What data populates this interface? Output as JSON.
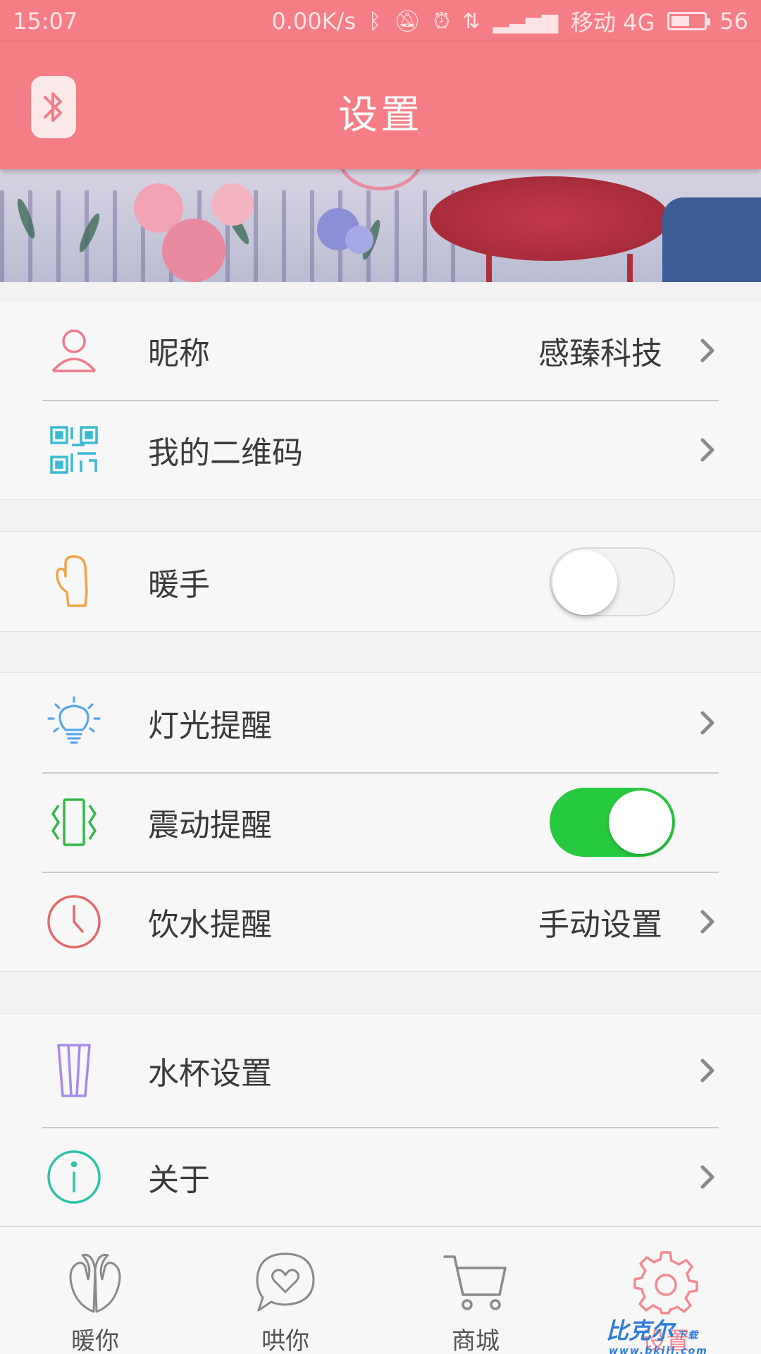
{
  "status_bar": {
    "time": "15:07",
    "net_speed": "0.00K/s",
    "carrier": "移动 4G",
    "battery": "56",
    "battery_level": 0.56
  },
  "header": {
    "title": "设置",
    "bluetooth_icon": "bluetooth-icon",
    "color": "#f57d86"
  },
  "groups": [
    {
      "items": [
        {
          "label": "昵称",
          "value": "感臻科技",
          "icon": "user-icon",
          "control": "chevron"
        },
        {
          "label": "我的二维码",
          "value": "",
          "icon": "qr-code-icon",
          "control": "chevron"
        }
      ]
    },
    {
      "items": [
        {
          "label": "暖手",
          "icon": "mitten-icon",
          "control": "toggle",
          "on": false
        }
      ]
    },
    {
      "items": [
        {
          "label": "灯光提醒",
          "value": "",
          "icon": "lightbulb-icon",
          "control": "chevron"
        },
        {
          "label": "震动提醒",
          "icon": "vibrate-icon",
          "control": "toggle",
          "on": true
        },
        {
          "label": "饮水提醒",
          "value": "手动设置",
          "icon": "clock-icon",
          "control": "chevron"
        }
      ]
    },
    {
      "items": [
        {
          "label": "水杯设置",
          "value": "",
          "icon": "cup-icon",
          "control": "chevron"
        },
        {
          "label": "关于",
          "value": "",
          "icon": "info-icon",
          "control": "chevron"
        }
      ]
    }
  ],
  "tabs": [
    {
      "label": "暖你",
      "icon": "hands-icon",
      "active": false
    },
    {
      "label": "哄你",
      "icon": "chat-heart-icon",
      "active": false
    },
    {
      "label": "商城",
      "icon": "cart-icon",
      "active": false
    },
    {
      "label": "设置",
      "icon": "gear-icon",
      "active": true
    }
  ],
  "watermark": {
    "text": "比克尔",
    "sub": "www.bkill.com",
    "badge": "下载"
  },
  "colors": {
    "accent": "#f57d86",
    "toggle_on": "#27c93f",
    "tab_active": "#f18a93"
  }
}
